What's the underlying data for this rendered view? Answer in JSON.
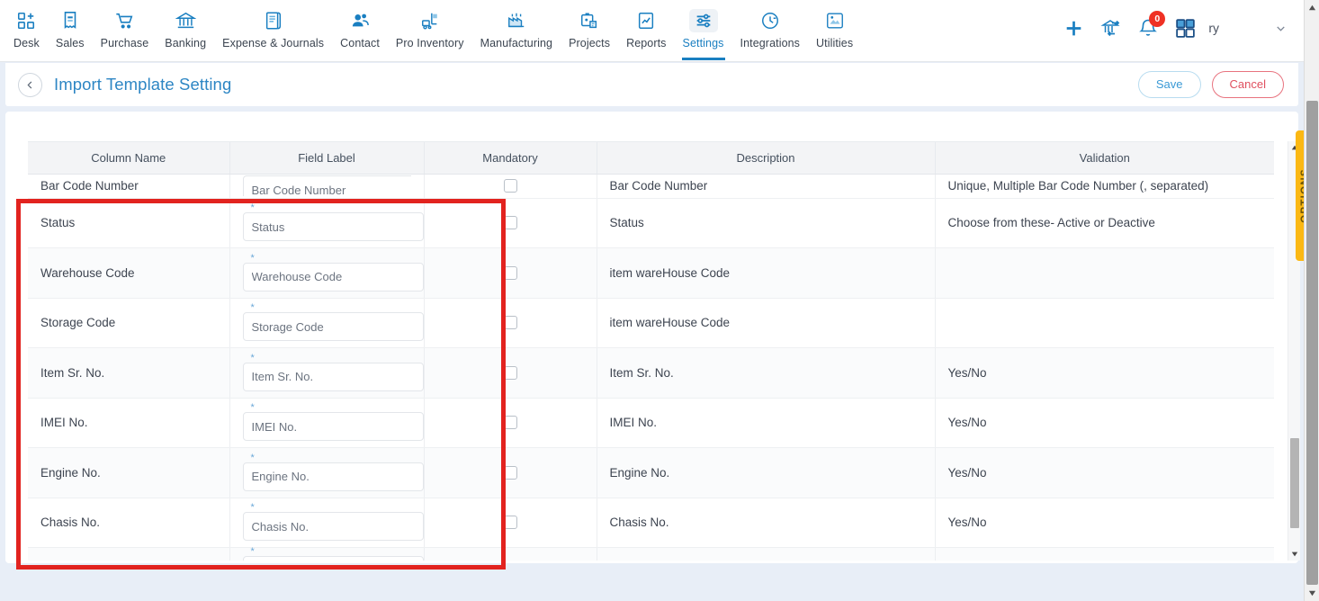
{
  "nav": {
    "items": [
      {
        "label": "Desk",
        "icon": "desk-add-icon",
        "active": false
      },
      {
        "label": "Sales",
        "icon": "receipt-icon",
        "active": false
      },
      {
        "label": "Purchase",
        "icon": "cart-icon",
        "active": false
      },
      {
        "label": "Banking",
        "icon": "bank-icon",
        "active": false
      },
      {
        "label": "Expense & Journals",
        "icon": "journal-book-icon",
        "active": false
      },
      {
        "label": "Contact",
        "icon": "contacts-icon",
        "active": false
      },
      {
        "label": "Pro Inventory",
        "icon": "forklift-icon",
        "active": false
      },
      {
        "label": "Manufacturing",
        "icon": "factory-icon",
        "active": false
      },
      {
        "label": "Projects",
        "icon": "projects-clipboard-icon",
        "active": false
      },
      {
        "label": "Reports",
        "icon": "report-chart-icon",
        "active": false
      },
      {
        "label": "Settings",
        "icon": "sliders-icon",
        "active": true
      },
      {
        "label": "Integrations",
        "icon": "plug-icon",
        "active": false
      },
      {
        "label": "Utilities",
        "icon": "utilities-icon",
        "active": false
      }
    ],
    "right": {
      "add_icon": "plus-icon",
      "transfer_icon": "bank-transfer-icon",
      "notification_icon": "bell-icon",
      "notification_count": "0",
      "apps_icon": "grid-apps-icon",
      "user_name": "ry",
      "caret_icon": "chevron-down-icon"
    }
  },
  "page": {
    "back_icon": "chevron-left-icon",
    "title": "Import Template Setting",
    "save_label": "Save",
    "cancel_label": "Cancel"
  },
  "options_panel": {
    "label": "OPTIONS"
  },
  "table": {
    "headers": [
      "Column Name",
      "Field Label",
      "Mandatory",
      "Description",
      "Validation"
    ],
    "rows": [
      {
        "column_name": "Bar Code Number",
        "field_label": "Bar Code Number",
        "mandatory": false,
        "description": "Bar Code Number",
        "validation": "Unique, Multiple Bar Code Number (, separated)",
        "clipped_top": true,
        "alt": false
      },
      {
        "column_name": "Status",
        "field_label": "Status",
        "mandatory": false,
        "description": "Status",
        "validation": "Choose from these- Active or Deactive",
        "clipped_top": false,
        "alt": false
      },
      {
        "column_name": "Warehouse Code",
        "field_label": "Warehouse Code",
        "mandatory": false,
        "description": "item wareHouse Code",
        "validation": "",
        "clipped_top": false,
        "alt": true
      },
      {
        "column_name": "Storage Code",
        "field_label": "Storage Code",
        "mandatory": false,
        "description": "item wareHouse Code",
        "validation": "",
        "clipped_top": false,
        "alt": false
      },
      {
        "column_name": "Item Sr. No.",
        "field_label": "Item Sr. No.",
        "mandatory": false,
        "description": "Item Sr. No.",
        "validation": "Yes/No",
        "clipped_top": false,
        "alt": true
      },
      {
        "column_name": "IMEI No.",
        "field_label": "IMEI No.",
        "mandatory": false,
        "description": "IMEI No.",
        "validation": "Yes/No",
        "clipped_top": false,
        "alt": false
      },
      {
        "column_name": "Engine No.",
        "field_label": "Engine No.",
        "mandatory": false,
        "description": "Engine No.",
        "validation": "Yes/No",
        "clipped_top": false,
        "alt": true
      },
      {
        "column_name": "Chasis No.",
        "field_label": "Chasis No.",
        "mandatory": false,
        "description": "Chasis No.",
        "validation": "Yes/No",
        "clipped_top": false,
        "alt": false
      },
      {
        "column_name": "",
        "field_label": "",
        "mandatory": false,
        "description": "",
        "validation": "",
        "clipped_top": false,
        "alt": true,
        "tail": true
      }
    ],
    "required_marker": "*"
  },
  "colors": {
    "accent_blue": "#2d86c4",
    "nav_icon_blue": "#1a7fc1",
    "cancel_red": "#e0505f",
    "badge_red": "#ef3124",
    "options_amber": "#fbb813",
    "annotation_red": "#e2231f",
    "page_bg": "#e8eef7"
  }
}
